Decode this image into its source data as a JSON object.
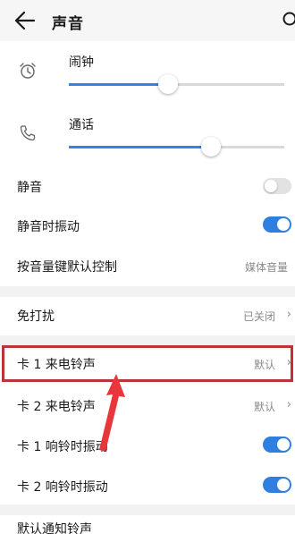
{
  "header": {
    "title": "声音"
  },
  "volume": {
    "alarm": {
      "label": "闹钟",
      "icon": "alarm-clock-icon",
      "level": 0.46
    },
    "call": {
      "label": "通话",
      "icon": "phone-icon",
      "level": 0.66
    }
  },
  "settings": {
    "mute": {
      "label": "静音",
      "enabled": false
    },
    "mute_vibrate": {
      "label": "静音时振动",
      "enabled": true
    },
    "volume_key": {
      "label": "按音量键默认控制",
      "value": "媒体音量"
    },
    "dnd": {
      "label": "免打扰",
      "value": "已关闭"
    },
    "sim1_ringtone": {
      "label": "卡 1 来电铃声",
      "value": "默认"
    },
    "sim2_ringtone": {
      "label": "卡 2 来电铃声",
      "value": "默认"
    },
    "sim1_vibrate": {
      "label": "卡 1 响铃时振动",
      "enabled": true
    },
    "sim2_vibrate": {
      "label": "卡 2 响铃时振动",
      "enabled": true
    },
    "notification_ringtone": {
      "label": "默认通知铃声"
    }
  },
  "colors": {
    "accent": "#2f7fe0",
    "annotation": "#c0323a"
  }
}
